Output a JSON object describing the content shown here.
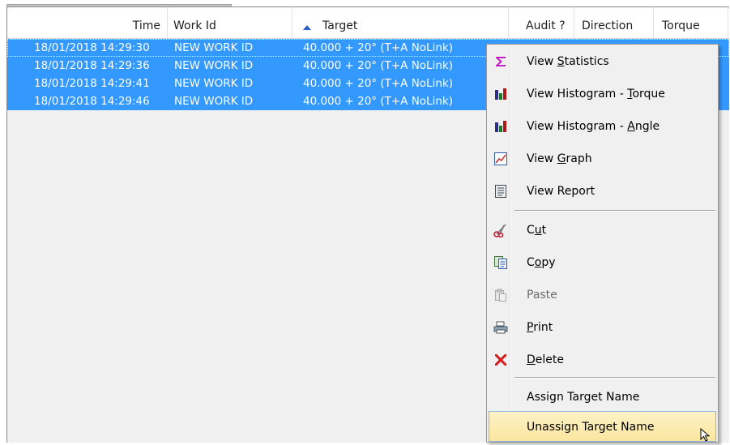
{
  "columns": [
    {
      "label": "Time"
    },
    {
      "label": "Work Id"
    },
    {
      "label": "Target",
      "sorted": "ascending"
    },
    {
      "label": "Audit ?"
    },
    {
      "label": "Direction"
    },
    {
      "label": "Torque"
    }
  ],
  "rows": [
    {
      "time": "18/01/2018 14:29:30",
      "work_id": "NEW WORK ID",
      "target": "40.000 + 20° (T+A NoLink)"
    },
    {
      "time": "18/01/2018 14:29:36",
      "work_id": "NEW WORK ID",
      "target": "40.000 + 20° (T+A NoLink)"
    },
    {
      "time": "18/01/2018 14:29:41",
      "work_id": "NEW WORK ID",
      "target": "40.000 + 20° (T+A NoLink)"
    },
    {
      "time": "18/01/2018 14:29:46",
      "work_id": "NEW WORK ID",
      "target": "40.000 + 20° (T+A NoLink)"
    }
  ],
  "context_menu": {
    "items": [
      {
        "pre": "View ",
        "acc": "S",
        "post": "tatistics",
        "icon": "sigma-icon",
        "enabled": true
      },
      {
        "pre": "View Histogram - ",
        "acc": "T",
        "post": "orque",
        "icon": "histogram-icon",
        "enabled": true
      },
      {
        "pre": "View Histogram - ",
        "acc": "A",
        "post": "ngle",
        "icon": "histogram-icon",
        "enabled": true
      },
      {
        "pre": "View ",
        "acc": "G",
        "post": "raph",
        "icon": "line-graph-icon",
        "enabled": true
      },
      {
        "pre": "View Report",
        "acc": "",
        "post": "",
        "icon": "report-icon",
        "enabled": true
      },
      {
        "pre": "C",
        "acc": "u",
        "post": "t",
        "icon": "scissors-icon",
        "enabled": true
      },
      {
        "pre": "C",
        "acc": "o",
        "post": "py",
        "icon": "copy-icon",
        "enabled": true
      },
      {
        "pre": "Paste",
        "acc": "",
        "post": "",
        "icon": "paste-icon",
        "enabled": false
      },
      {
        "pre": "",
        "acc": "P",
        "post": "rint",
        "icon": "printer-icon",
        "enabled": true
      },
      {
        "pre": "",
        "acc": "D",
        "post": "elete",
        "icon": "delete-x-icon",
        "enabled": true
      },
      {
        "pre": "Assign Target Name",
        "acc": "",
        "post": "",
        "icon": "",
        "enabled": true
      },
      {
        "pre": "Unassign Target Name",
        "acc": "",
        "post": "",
        "icon": "",
        "enabled": true,
        "hovered": true
      }
    ]
  },
  "colors": {
    "selection": "#3399ff",
    "menu_bg": "#f0f0f0",
    "hover_bg": "#fbe6a0",
    "sort_arrow": "#2b60c6"
  }
}
